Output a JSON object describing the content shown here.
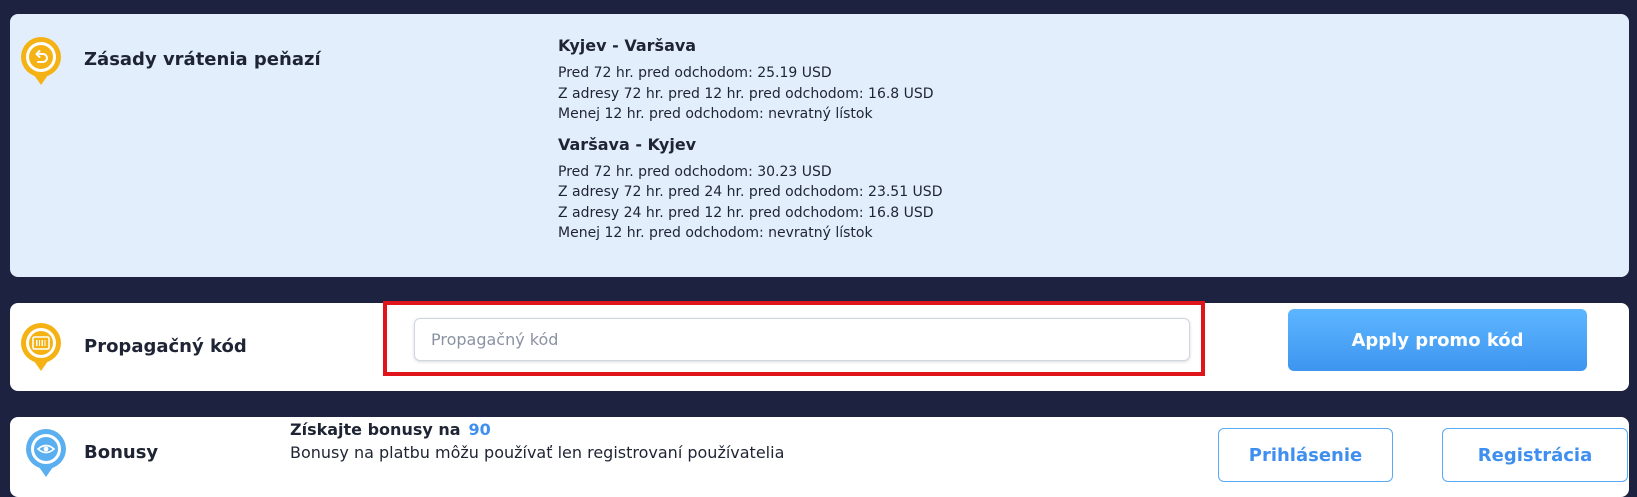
{
  "refund": {
    "title": "Zásady vrátenia peňazí",
    "icon": "refund-arrow-icon",
    "routes": [
      {
        "name": "Kyjev - Varšava",
        "rules": [
          "Pred 72 hr. pred odchodom: 25.19 USD",
          "Z adresy 72 hr. pred 12 hr. pred odchodom: 16.8 USD",
          "Menej 12 hr. pred odchodom: nevratný lístok"
        ]
      },
      {
        "name": "Varšava - Kyjev",
        "rules": [
          "Pred 72 hr. pred odchodom: 30.23 USD",
          "Z adresy 72 hr. pred 24 hr. pred odchodom: 23.51 USD",
          "Z adresy 24 hr. pred 12 hr. pred odchodom: 16.8 USD",
          "Menej 12 hr. pred odchodom: nevratný lístok"
        ]
      }
    ]
  },
  "promo": {
    "title": "Propagačný kód",
    "icon": "barcode-icon",
    "input_placeholder": "Propagačný kód",
    "input_value": "",
    "apply_label": "Apply promo kód"
  },
  "bonus": {
    "title": "Bonusy",
    "icon": "bonus-eye-icon",
    "headline_text": "Získajte bonusy na",
    "headline_amount": "90",
    "note": "Bonusy na platbu môžu používať len registrovaní používatelia",
    "login_label": "Prihlásenie",
    "register_label": "Registrácia"
  },
  "colors": {
    "background": "#1d2240",
    "refund_card": "#e3eefc",
    "accent_gold": "#f5b214",
    "accent_blue": "#3f8ff0",
    "highlight_red": "#e0151b"
  }
}
